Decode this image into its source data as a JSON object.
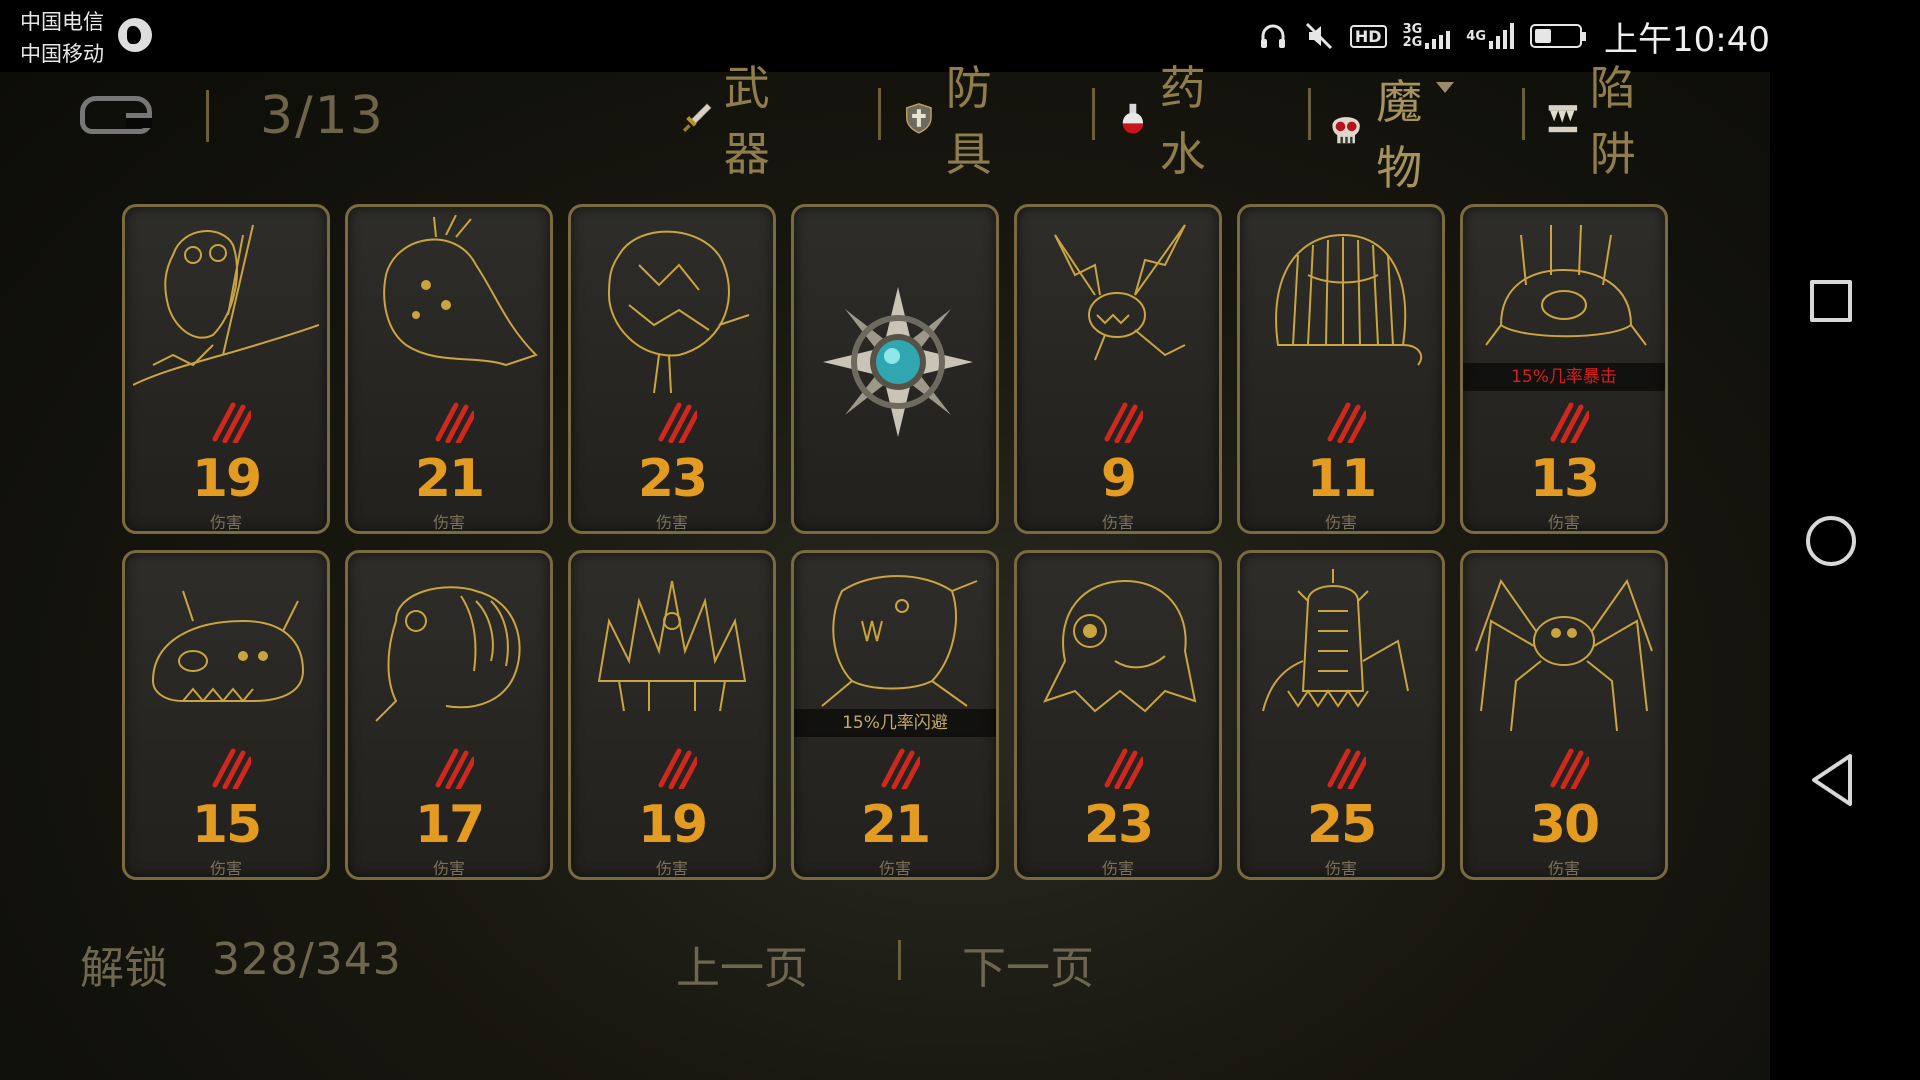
{
  "status_bar": {
    "carrier1": "中国电信",
    "carrier2": "中国移动",
    "hd": "HD",
    "net1": "3G",
    "net2": "2G",
    "net3": "4G",
    "time": "上午10:40"
  },
  "header": {
    "page_indicator": "3/13",
    "tabs": [
      {
        "label": "武器",
        "icon": "sword-icon"
      },
      {
        "label": "防具",
        "icon": "shield-icon"
      },
      {
        "label": "药水",
        "icon": "potion-icon"
      },
      {
        "label": "魔物",
        "icon": "skull-icon",
        "active": true
      },
      {
        "label": "陷阱",
        "icon": "trap-icon"
      }
    ]
  },
  "cards": [
    {
      "value": "19",
      "label": "伤害",
      "monster": "owl-on-branch"
    },
    {
      "value": "21",
      "label": "伤害",
      "monster": "spotted-bird"
    },
    {
      "value": "23",
      "label": "伤害",
      "monster": "feathered-beast"
    },
    {
      "value": null,
      "label": "",
      "monster": "locked-compass-gem"
    },
    {
      "value": "9",
      "label": "伤害",
      "monster": "bat-dragon"
    },
    {
      "value": "11",
      "label": "伤害",
      "monster": "hairy-blob"
    },
    {
      "value": "13",
      "label": "伤害",
      "monster": "horned-crab",
      "trait": "15%几率暴击",
      "trait_color": "red"
    },
    {
      "value": "15",
      "label": "伤害",
      "monster": "horned-beetle"
    },
    {
      "value": "17",
      "label": "伤害",
      "monster": "larva"
    },
    {
      "value": "19",
      "label": "伤害",
      "monster": "crystal-crown"
    },
    {
      "value": "21",
      "label": "伤害",
      "monster": "frog-demon",
      "trait": "15%几率闪避",
      "trait_color": "gold"
    },
    {
      "value": "23",
      "label": "伤害",
      "monster": "one-eyed-ghost"
    },
    {
      "value": "25",
      "label": "伤害",
      "monster": "spiked-cactus"
    },
    {
      "value": "30",
      "label": "伤害",
      "monster": "giant-spider"
    }
  ],
  "footer": {
    "unlock_label": "解锁",
    "unlock_count": "328/343",
    "prev_page": "上一页",
    "next_page": "下一页"
  },
  "colors": {
    "damage": "#e39b22",
    "card_border": "#7a6a3f",
    "art_stroke": "#c9a440",
    "claw": "#d0281e"
  }
}
